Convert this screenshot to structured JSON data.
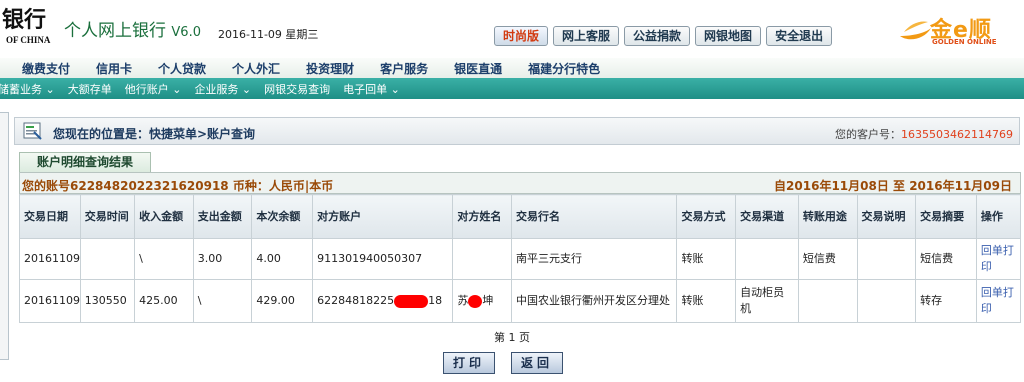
{
  "header": {
    "bank_name": "银行",
    "bank_en": "OF CHINA",
    "system_title": "个人网上银行",
    "version": "V6.0",
    "date": "2016-11-09 星期三",
    "buttons": [
      "时尚版",
      "网上客服",
      "公益捐款",
      "网银地图",
      "安全退出"
    ],
    "logo_text": "金e顺",
    "logo_en": "GOLDEN ONLINE"
  },
  "main_nav": [
    "缴费支付",
    "信用卡",
    "个人贷款",
    "个人外汇",
    "投资理财",
    "客户服务",
    "银医直通",
    "福建分行特色"
  ],
  "sub_nav": [
    "储蓄业务 ⌄",
    "大额存单",
    "他行账户 ⌄",
    "企业服务 ⌄",
    "网银交易查询",
    "电子回单 ⌄"
  ],
  "location": {
    "text": "您现在的位置是：快捷菜单>账户查询",
    "customer_label": "您的客户号：",
    "customer_no": "1635503462114769"
  },
  "tab": "账户明细查询结果",
  "account_bar": {
    "left": "您的账号6228482022321620918 币种：人民币|本币",
    "right": "自2016年11月08日 至 2016年11月09日"
  },
  "table": {
    "headers": [
      "交易日期",
      "交易时间",
      "收入金额",
      "支出金额",
      "本次余额",
      "对方账户",
      "对方姓名",
      "交易行名",
      "交易方式",
      "交易渠道",
      "转账用途",
      "交易说明",
      "交易摘要",
      "操作"
    ],
    "rows": [
      {
        "date": "20161109",
        "time": "",
        "income": "\\",
        "expense": "3.00",
        "balance": "4.00",
        "cp_account": "911301940050307",
        "cp_name": "",
        "bank": "南平三元支行",
        "method": "转账",
        "channel": "",
        "purpose": "短信费",
        "note": "",
        "summary": "短信费",
        "op": "回单打印"
      },
      {
        "date": "20161109",
        "time": "130550",
        "income": "425.00",
        "expense": "\\",
        "balance": "429.00",
        "cp_account_a": "62284818225",
        "cp_account_b": "18",
        "cp_name_a": "苏",
        "cp_name_b": "坤",
        "bank": "中国农业银行衢州开发区分理处",
        "method": "转账",
        "channel": "自动柜员机",
        "purpose": "",
        "note": "",
        "summary": "转存",
        "op": "回单打印"
      }
    ]
  },
  "pager": "第 1 页",
  "buttons": {
    "print": "打印",
    "back": "返回"
  },
  "colors": {
    "accent_green": "#1f8f86",
    "brand_text": "#1a6f3c",
    "account_text": "#9a4a08",
    "customer_no": "#e0401c",
    "logo_gold": "#f29a14"
  }
}
